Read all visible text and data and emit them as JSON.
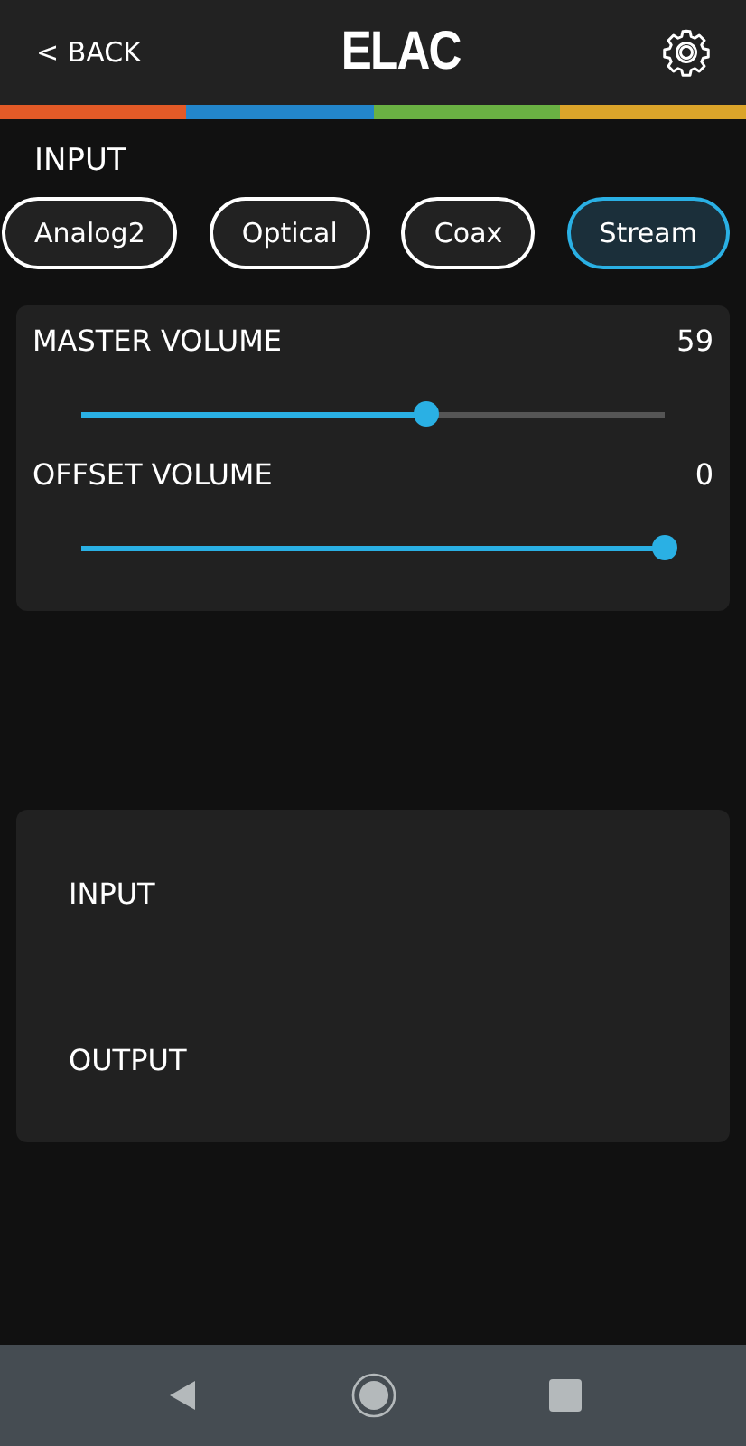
{
  "header": {
    "back": "< BACK",
    "logo": "ELAC"
  },
  "input_label": "INPUT",
  "inputs": [
    {
      "label": "Analog2",
      "selected": false
    },
    {
      "label": "Optical",
      "selected": false
    },
    {
      "label": "Coax",
      "selected": false
    },
    {
      "label": "Stream",
      "selected": true
    }
  ],
  "volumes": [
    {
      "name": "MASTER VOLUME",
      "reading": "59",
      "level": 0.59
    },
    {
      "name": "OFFSET VOLUME",
      "reading": "0",
      "level": 1
    }
  ],
  "routing": [
    "INPUT",
    "OUTPUT"
  ]
}
